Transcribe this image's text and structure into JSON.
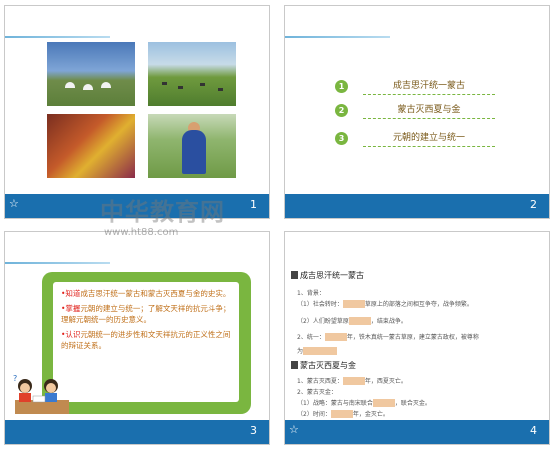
{
  "slide1": {
    "number": "1",
    "star": "☆"
  },
  "slide2": {
    "number": "2",
    "items": [
      {
        "bullet": "1",
        "text": "成吉思汗统一蒙古"
      },
      {
        "bullet": "2",
        "text": "蒙古灭西夏与金"
      },
      {
        "bullet": "3",
        "text": "元朝的建立与统一"
      }
    ]
  },
  "slide3": {
    "number": "3",
    "goals": [
      {
        "kw": "•知道",
        "rest": "成吉思汗统一蒙古和蒙古灭西夏与金的史实。"
      },
      {
        "kw": "•掌握",
        "rest": "元朝的建立与统一；了解文天祥的抗元斗争；理解元朝统一的历史意义。"
      },
      {
        "kw": "•认识",
        "rest": "元朝统一的进步性和文天祥抗元的正义性之间的辩证关系。"
      }
    ]
  },
  "slide4": {
    "number": "4",
    "star": "☆",
    "h1": "成吉思汗统一蒙古",
    "l1": "1、背景：",
    "l2a": "（1）社会转时：",
    "l2b": "草原上的部落之间相互争夺，战争频繁。",
    "l3a": "（2）人们盼望草原",
    "l3b": "，结束战争。",
    "l4a": "2、统一：",
    "l4b": "年，铁木真统一蒙古草原，建立蒙古政权，被尊称",
    "l5a": "为",
    "h2": "蒙古灭西夏与金",
    "l6a": "1、蒙古灭西夏：",
    "l6b": "年，西夏灭亡。",
    "l7": "2、蒙古灭金：",
    "l8a": "（1）战略：蒙古与南宋联合",
    "l8b": "，联合灭金。",
    "l9a": "（2）时间：",
    "l9b": "年，金灭亡。",
    "watermark": "中华教育网",
    "watermark_url": "www.ht88.com"
  }
}
